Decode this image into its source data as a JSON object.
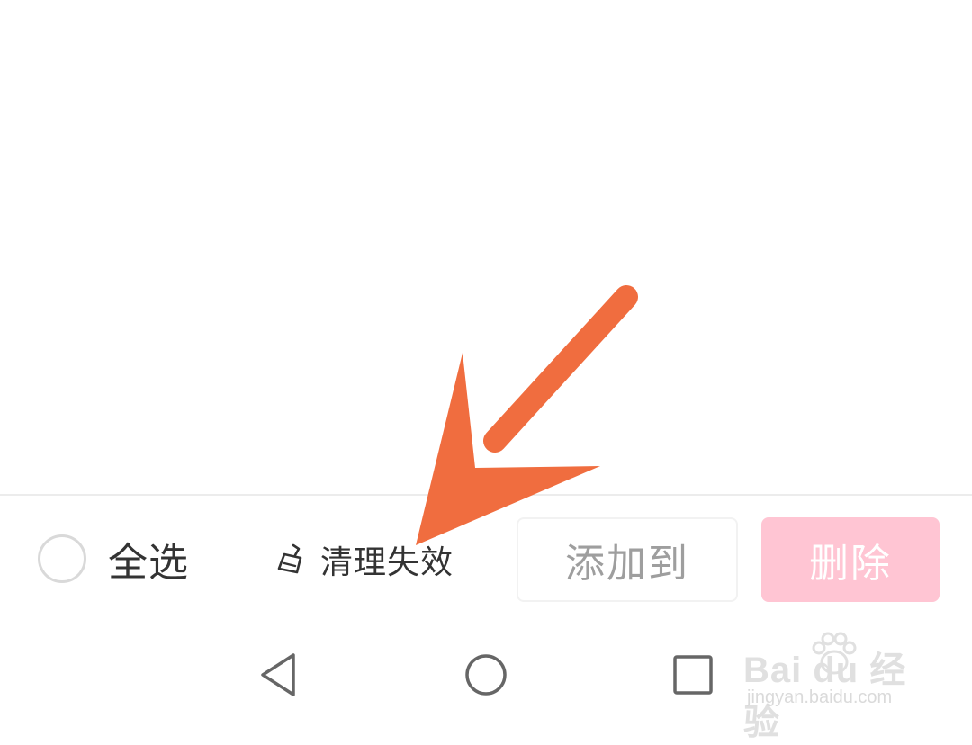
{
  "bottom_bar": {
    "select_all_label": "全选",
    "clean_invalid_label": "清理失效",
    "add_to_label": "添加到",
    "delete_label": "删除"
  },
  "icons": {
    "select_all": "radio-circle-icon",
    "clean_invalid": "broom-icon",
    "nav_back": "triangle-back-icon",
    "nav_home": "circle-home-icon",
    "nav_recent": "square-recent-icon",
    "annotation": "arrow-icon",
    "watermark": "baidu-paw-icon"
  },
  "colors": {
    "text": "#333333",
    "disabled_text": "#9e9e9e",
    "delete_bg": "#ffc5d3",
    "arrow": "#f06d3f"
  },
  "watermark": {
    "brand": "Bai du 经验",
    "url": "jingyan.baidu.com"
  }
}
